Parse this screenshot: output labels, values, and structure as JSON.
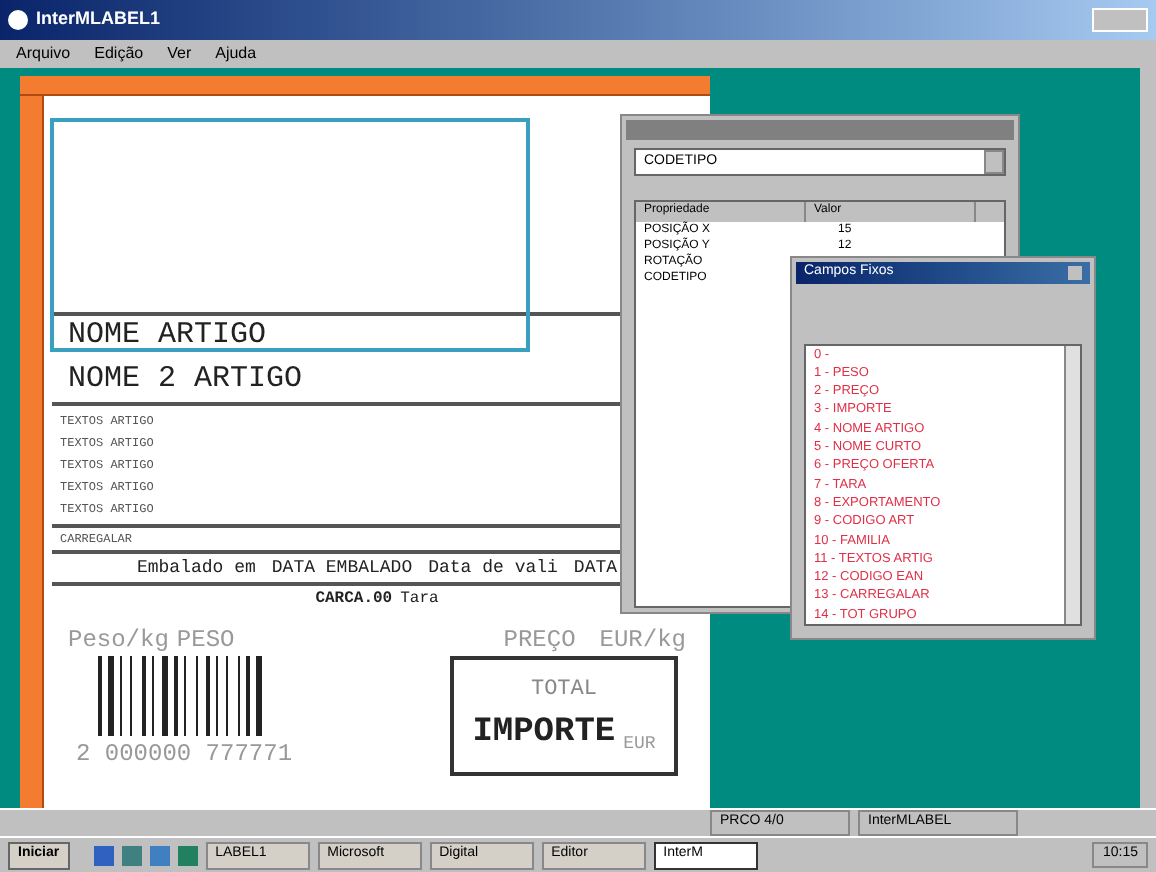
{
  "window": {
    "title": "InterMLABEL1"
  },
  "menu": [
    "Arquivo",
    "Edição",
    "Ver",
    "Ajuda"
  ],
  "label": {
    "name_lines": [
      "NOME ARTIGO",
      "NOME 2 ARTIGO"
    ],
    "text_lines": [
      "TEXTOS ARTIGO",
      "TEXTOS ARTIGO",
      "TEXTOS ARTIGO",
      "TEXTOS ARTIGO",
      "TEXTOS ARTIGO"
    ],
    "carregalar": "CARREGALAR",
    "packed_line": [
      "Embalado em",
      "DATA EMBALADO",
      "Data de vali",
      "DATA"
    ],
    "tare_value": "CARCA.00",
    "tare_label": "Tara",
    "weight_label": "Peso/kg",
    "weight_field": "PESO",
    "price_field": "PREÇO",
    "price_unit": "EUR/kg",
    "barcode_number": "2 000000 777771",
    "total_label": "TOTAL",
    "total_field": "IMPORTE",
    "total_unit": "EUR"
  },
  "properties": {
    "dropdown": "CODETIPO",
    "columns": [
      "Propriedade",
      "Valor"
    ],
    "rows": [
      {
        "name": "POSIÇÃO X",
        "value": "15"
      },
      {
        "name": "POSIÇÃO Y",
        "value": "12"
      },
      {
        "name": "ROTAÇÃO",
        "value": ""
      },
      {
        "name": "CODETIPO",
        "value": ""
      }
    ]
  },
  "fields_window": {
    "title": "Campos Fixos",
    "items": [
      "0 -",
      "1 - PESO",
      "2 - PREÇO",
      "3 - IMPORTE",
      "4 - NOME ARTIGO",
      "5 - NOME CURTO",
      "6 - PREÇO OFERTA",
      "7 - TARA",
      "8 - EXPORTAMENTO",
      "9 - CODIGO ART",
      "10 - FAMILIA",
      "11 - TEXTOS ARTIG",
      "12 - CODIGO EAN",
      "13 - CARREGALAR",
      "14 - TOT GRUPO"
    ]
  },
  "status_bar": [
    "PRCO 4/0",
    "InterMLABEL"
  ],
  "taskbar": {
    "start": "Iniciar",
    "tasks": [
      {
        "label": "LABEL1",
        "selected": false
      },
      {
        "label": "Microsoft",
        "selected": false
      },
      {
        "label": "Digital",
        "selected": false
      },
      {
        "label": "Editor",
        "selected": false
      },
      {
        "label": "InterM",
        "selected": true
      }
    ],
    "clock": "10:15"
  }
}
